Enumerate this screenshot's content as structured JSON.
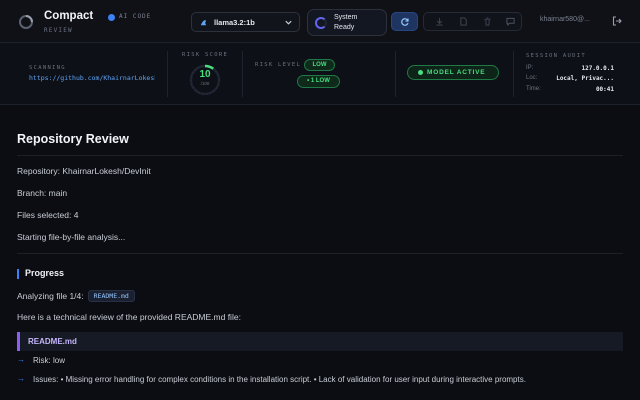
{
  "header": {
    "brand": "Compact",
    "brand_tag": "AI CODE",
    "brand_sub": "REVIEW",
    "model": "llama3.2:1b",
    "status_line1": "System",
    "status_line2": "Ready",
    "user": "khairnar580@...",
    "icons": [
      "logo-icon",
      "model-icon",
      "chevron-down-icon",
      "refresh-icon",
      "download-icon",
      "file-icon",
      "trash-icon",
      "chat-icon",
      "logout-icon"
    ]
  },
  "strip": {
    "scanning_label": "SCANNING",
    "scanning_url": "https://github.com/KhairnarLokesh/DevInit",
    "risk_score_label": "RISK SCORE",
    "risk_score": "10",
    "risk_score_fraction": 0.1,
    "risk_score_unit": "/100",
    "risk_level_label": "RISK LEVEL",
    "risk_level": "LOW",
    "risk_count": "• 1 LOW",
    "model_status": "MODEL ACTIVE",
    "audit_title": "SESSION AUDIT",
    "audit": [
      {
        "key": "IP:",
        "value": "127.0.0.1"
      },
      {
        "key": "Loc:",
        "value": "Local, Privac..."
      },
      {
        "key": "Time:",
        "value": "00:41"
      }
    ]
  },
  "main": {
    "title": "Repository Review",
    "repository": "Repository: KhairnarLokesh/DevInit",
    "branch": "Branch: main",
    "files": "Files selected: 4",
    "starting": "Starting file-by-file analysis...",
    "progress_title": "Progress",
    "analyzing": "Analyzing file 1/4:",
    "analyzing_file": "README.md",
    "intro": "Here is a technical review of the provided README.md file:",
    "file_block": "README.md",
    "risk_item": "Risk: low",
    "issues_item": "Issues: • Missing error handling for complex conditions in the installation script. • Lack of validation for user input during interactive prompts."
  },
  "colors": {
    "accent": "#3b82f6",
    "success": "#4ade80",
    "purple": "#8b5cf6",
    "background": "#0b0d12"
  }
}
